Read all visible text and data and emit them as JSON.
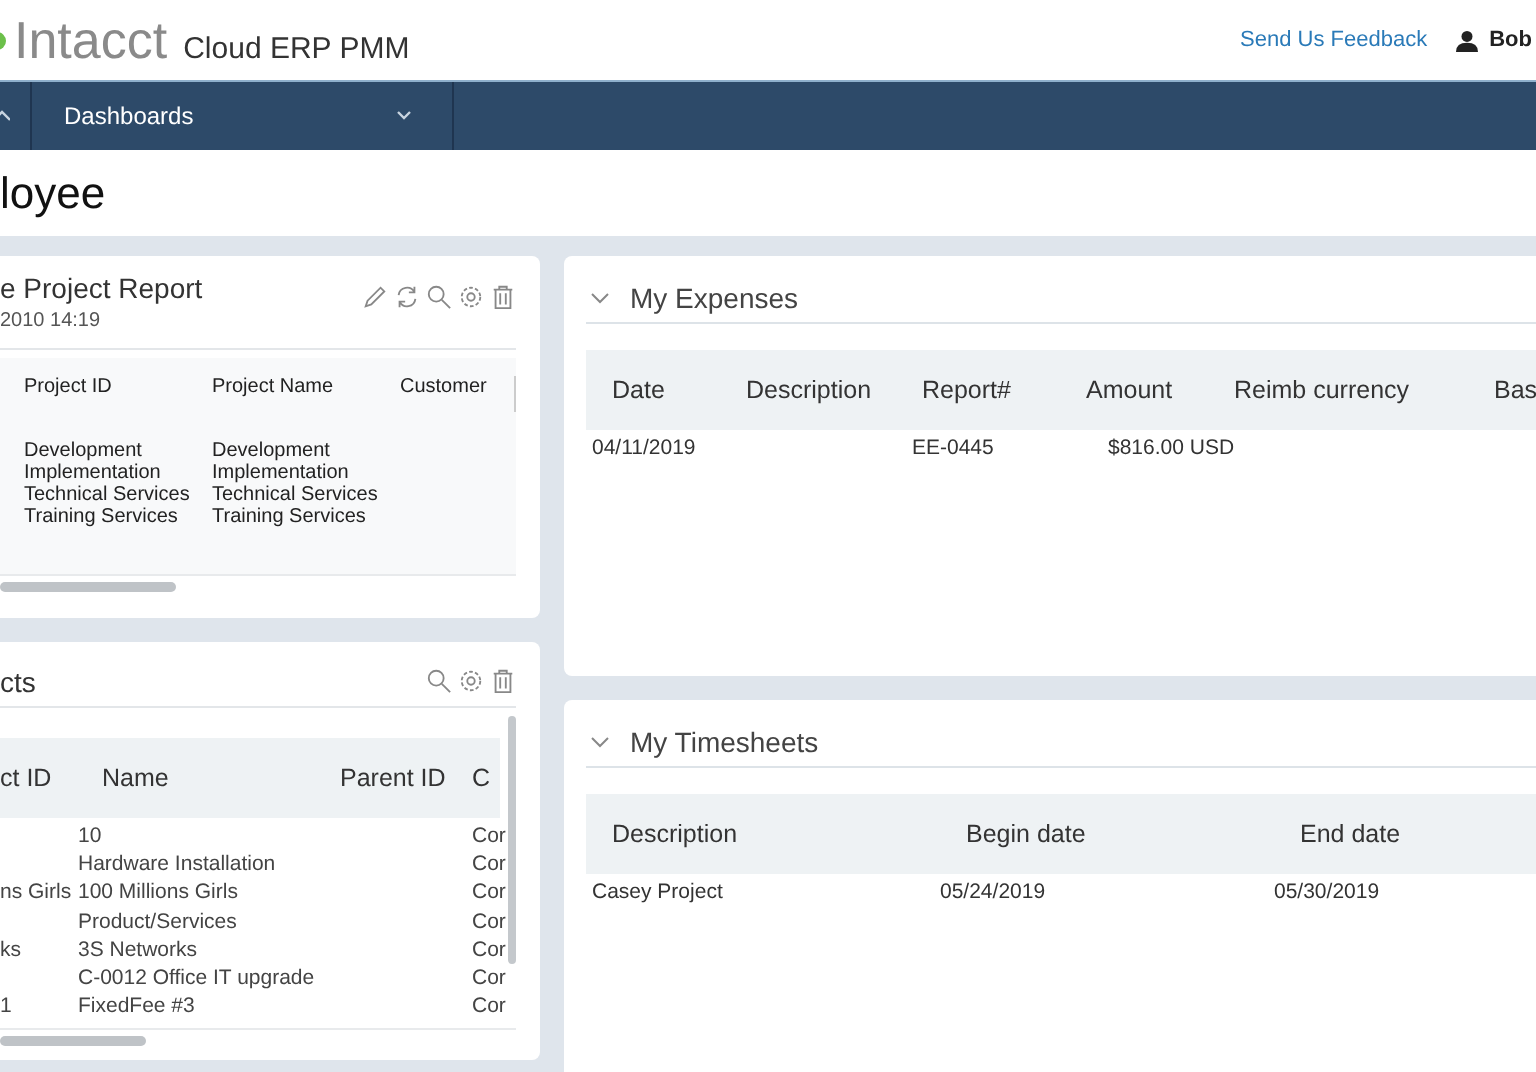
{
  "header": {
    "logo": "Intacct",
    "product": "Cloud ERP PMM",
    "feedback_link": "Send Us Feedback",
    "user": "Bob"
  },
  "nav": {
    "items": [
      {
        "label": "Dashboards"
      }
    ]
  },
  "page_title": "loyee",
  "project_report": {
    "title": "e Project Report",
    "timestamp": "2010 14:19",
    "columns": [
      "Project ID",
      "Project Name",
      "Customer"
    ],
    "rows": [
      [
        [
          "Development",
          "Implementation",
          "Technical Services",
          "Training Services"
        ],
        [
          "Development",
          "Implementation",
          "Technical Services",
          "Training Services"
        ]
      ]
    ]
  },
  "projects": {
    "title": "cts",
    "columns": [
      "ct ID",
      "Name",
      "Parent ID",
      "C"
    ],
    "rows": [
      {
        "name": "10",
        "column_4": "Cor"
      },
      {
        "name": "Hardware Installation",
        "column_4": "Cor"
      },
      {
        "id": "ns Girls",
        "name": "100 Millions Girls",
        "column_4": "Cor"
      },
      {
        "name": "Product/Services",
        "column_4": "Cor"
      },
      {
        "id": "ks",
        "name": "3S Networks",
        "column_4": "Cor"
      },
      {
        "name": "C-0012 Office IT upgrade",
        "column_4": "Cor"
      },
      {
        "id": "1",
        "name": "FixedFee #3",
        "column_4": "Cor"
      }
    ]
  },
  "my_expenses": {
    "title": "My Expenses",
    "columns": [
      "Date",
      "Description",
      "Report#",
      "Amount",
      "Reimb currency",
      "Bas"
    ],
    "rows": [
      [
        "04/11/2019",
        "",
        "EE-0445",
        "$816.00 USD"
      ]
    ]
  },
  "my_timesheets": {
    "title": "My Timesheets",
    "columns": [
      "Description",
      "Begin date",
      "End date"
    ],
    "rows": [
      [
        "Casey Project",
        "05/24/2019",
        "05/30/2019"
      ]
    ]
  }
}
